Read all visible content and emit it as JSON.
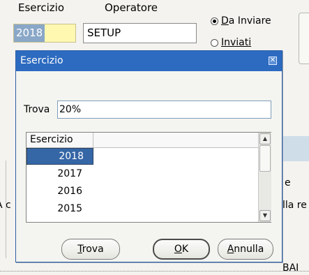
{
  "background": {
    "header_esercizio": "Esercizio",
    "header_operatore": "Operatore",
    "esercizio_value": "2018",
    "operatore_value": "SETUP",
    "radio_da_inviare": "Da Inviare",
    "radio_inviati": "Inviati",
    "frag_e": "e",
    "frag_la_re": "lla re",
    "frag_a": "A c",
    "frag_bottom": "BAI"
  },
  "dialog": {
    "title": "Esercizio",
    "close_glyph": "✕",
    "find_label": "Trova",
    "find_value": "20%",
    "list_header": "Esercizio",
    "rows": [
      "2018",
      "2017",
      "2016",
      "2015"
    ],
    "buttons": {
      "trova_mnemonic": "T",
      "trova_rest": "rova",
      "ok_mnemonic": "O",
      "ok_rest": "K",
      "annulla_mnemonic": "A",
      "annulla_rest": "nnulla"
    }
  }
}
